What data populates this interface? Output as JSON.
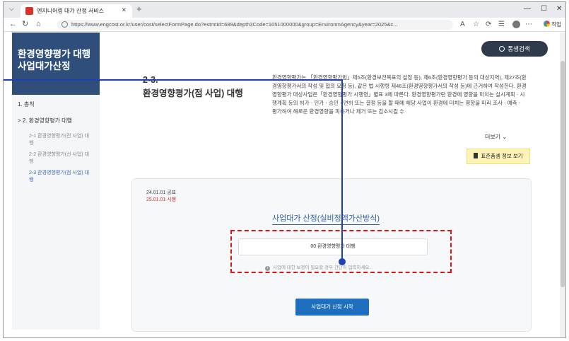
{
  "browser": {
    "tab_title": "엔지니어링 대가 산정 서비스",
    "url": "https://www.engcost.or.kr/user/cost/selectFormPage.do?estmtId=689&depth3Code=1051000000&group=EnvironmAgency&year=2025&c...",
    "profile_label": "작업"
  },
  "sidebar": {
    "title": "환경영향평가 대행 사업대가산정",
    "items": [
      {
        "label": "1. 총칙"
      },
      {
        "label": "> 2. 환경영향평가 대행"
      },
      {
        "label": "2-1 환경영향평가(전 사업) 대행"
      },
      {
        "label": "2-2 환경영향평가(선 사업) 대행"
      },
      {
        "label": "2-3 환경영향평가(점 사업) 대행"
      }
    ]
  },
  "header": {
    "search_label": "통생검색"
  },
  "section": {
    "number": "2-3.",
    "title": "환경영향평가(점 사업) 대행",
    "description": "환경영향평가는 「환경영향평가법」제5조(환경보전목표의 설정 등), 제6조(환경영향평가 등의 대상지역), 제27조(환경영향평가서의 작성 및 협의 요청 등), 같은 법 시행령 제46조(환경영향평가서의 작성 등)에 근거하여 작성한다. 환경영향평가 대상사업은「환경영향평가 시행령」별표 3에 따른다. 환경영향평가란 환경에 영향을 미치는 실시계획ㆍ시행계획 등의 허가ㆍ인가ㆍ승인ㆍ면허 또는 결정 등을 할 때에 해당 사업이 환경에 미치는 영향을 미리 조사ㆍ예측ㆍ평가하여 해로운 환경영향을 피하거나 제거 또는 감소시킬 수",
    "more_label": "더보기",
    "standard_button": "표준품셈 정보 보기"
  },
  "card": {
    "announce_date": "24.01.01 공표",
    "effective_date": "25.01.01 시행",
    "calc_title": "사업대가 산정(실비정액가산방식)",
    "selected_item": "00 환경영향평가 대행",
    "notice": "사업에 대한 보정이 필요할 경우 간단히 입력하세요.",
    "start_button": "사업대가 산정 시작"
  },
  "colors": {
    "sidebar_header": "#2f4f7a",
    "accent_blue": "#1f6fc1",
    "highlight_red": "#e01414",
    "annotation": "#1f3fb5"
  }
}
